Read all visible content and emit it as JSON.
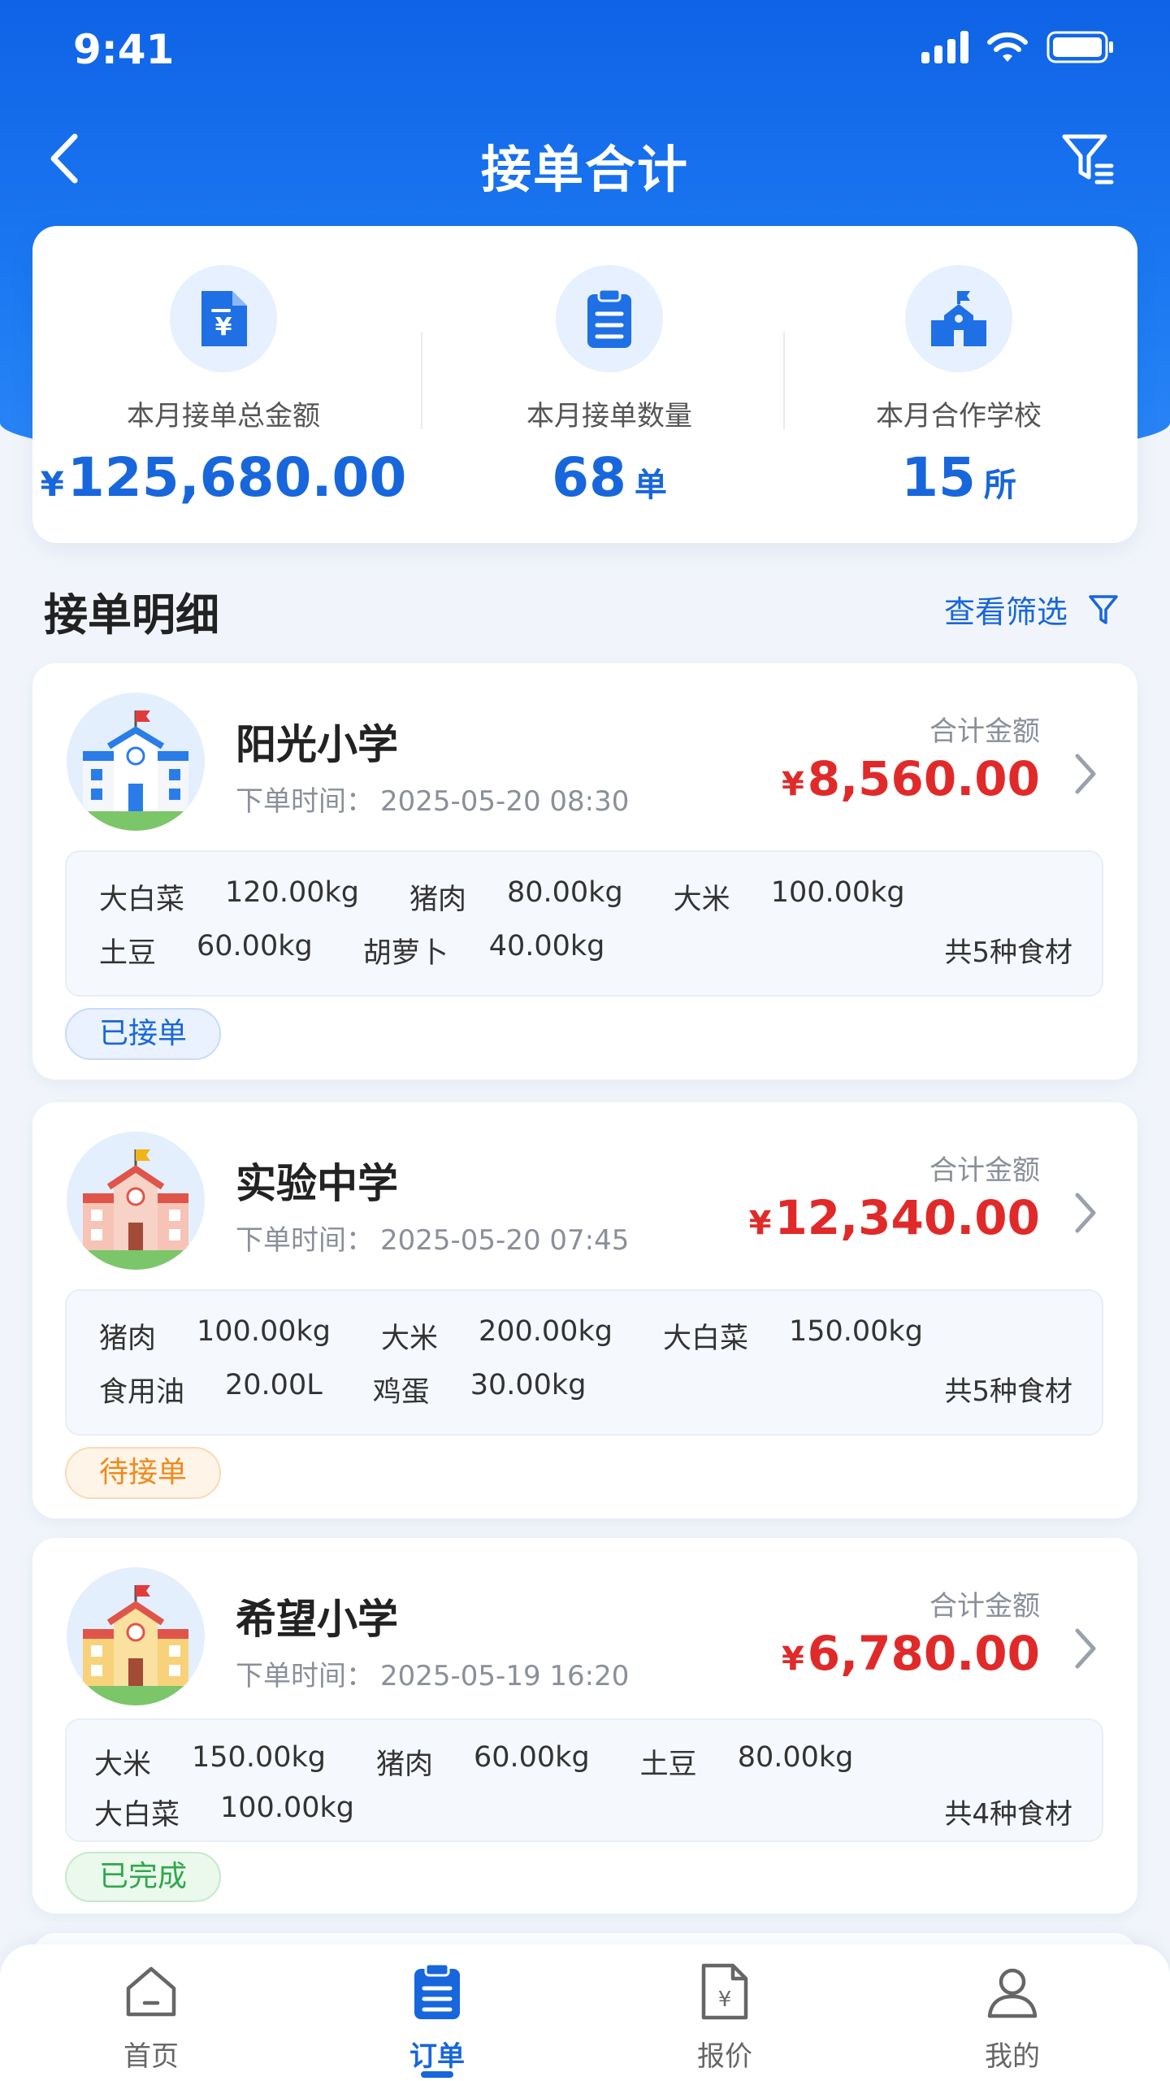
{
  "status_bar": {
    "time": "9:41"
  },
  "nav": {
    "title": "接单合计"
  },
  "summary": {
    "amount": {
      "label": "本月接单总金额",
      "currency": "¥",
      "value": "125,680.00"
    },
    "count": {
      "label": "本月接单数量",
      "value": "68",
      "unit": "单"
    },
    "schools": {
      "label": "本月合作学校",
      "value": "15",
      "unit": "所"
    }
  },
  "section": {
    "title": "接单明细",
    "link": "查看筛选"
  },
  "orders": [
    {
      "name": "阳光小学",
      "time_label": "下单时间：",
      "time": "2025-05-20 08:30",
      "total_label": "合计金额",
      "currency": "¥",
      "total": "8,560.00",
      "row1": [
        {
          "name": "大白菜",
          "qty": "120.00kg"
        },
        {
          "name": "猪肉",
          "qty": "80.00kg"
        },
        {
          "name": "大米",
          "qty": "100.00kg"
        }
      ],
      "row2": [
        {
          "name": "土豆",
          "qty": "60.00kg"
        },
        {
          "name": "胡萝卜",
          "qty": "40.00kg"
        }
      ],
      "count": "共5种食材",
      "status": "已接单"
    },
    {
      "name": "实验中学",
      "time_label": "下单时间：",
      "time": "2025-05-20 07:45",
      "total_label": "合计金额",
      "currency": "¥",
      "total": "12,340.00",
      "row1": [
        {
          "name": "猪肉",
          "qty": "100.00kg"
        },
        {
          "name": "大米",
          "qty": "200.00kg"
        },
        {
          "name": "大白菜",
          "qty": "150.00kg"
        }
      ],
      "row2": [
        {
          "name": "食用油",
          "qty": "20.00L"
        },
        {
          "name": "鸡蛋",
          "qty": "30.00kg"
        }
      ],
      "count": "共5种食材",
      "status": "待接单"
    },
    {
      "name": "希望小学",
      "time_label": "下单时间：",
      "time": "2025-05-19 16:20",
      "total_label": "合计金额",
      "currency": "¥",
      "total": "6,780.00",
      "row1": [
        {
          "name": "大米",
          "qty": "150.00kg"
        },
        {
          "name": "猪肉",
          "qty": "60.00kg"
        },
        {
          "name": "土豆",
          "qty": "80.00kg"
        }
      ],
      "row2": [
        {
          "name": "大白菜",
          "qty": "100.00kg"
        }
      ],
      "count": "共4种食材",
      "status": "已完成"
    }
  ],
  "tabs": [
    {
      "label": "首页",
      "icon": "home-icon"
    },
    {
      "label": "订单",
      "icon": "order-icon"
    },
    {
      "label": "报价",
      "icon": "quote-icon"
    },
    {
      "label": "我的",
      "icon": "user-icon"
    }
  ],
  "colors": {
    "primary": "#1866dc",
    "price": "#e02a2a",
    "pending": "#f08a1a",
    "done": "#2ea84a"
  }
}
